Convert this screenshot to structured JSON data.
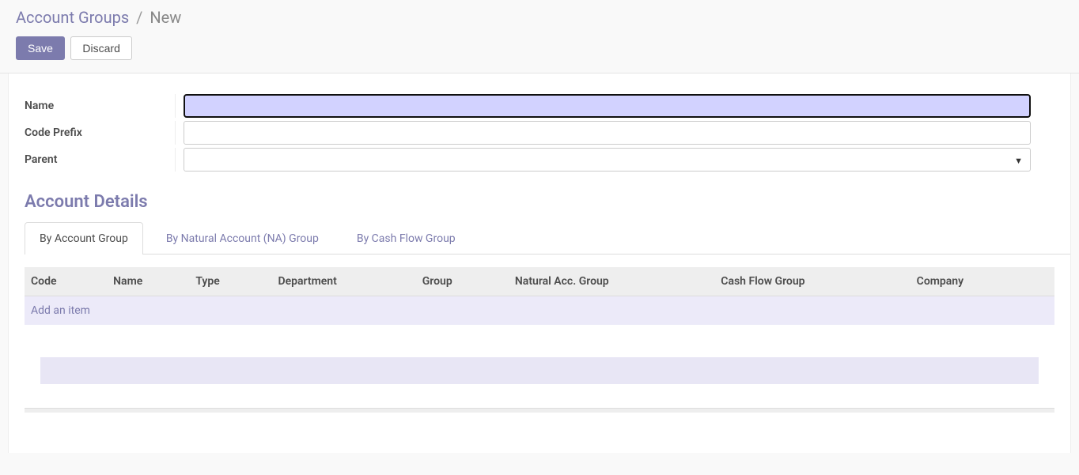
{
  "breadcrumb": {
    "parent": "Account Groups",
    "current": "New"
  },
  "actions": {
    "save": "Save",
    "discard": "Discard"
  },
  "form": {
    "name_label": "Name",
    "name_value": "",
    "code_prefix_label": "Code Prefix",
    "code_prefix_value": "",
    "parent_label": "Parent",
    "parent_value": ""
  },
  "section_title": "Account Details",
  "tabs": [
    {
      "label": "By Account Group",
      "active": true
    },
    {
      "label": "By Natural Account (NA) Group",
      "active": false
    },
    {
      "label": "By Cash Flow Group",
      "active": false
    }
  ],
  "table": {
    "columns": [
      "Code",
      "Name",
      "Type",
      "Department",
      "Group",
      "Natural Acc. Group",
      "Cash Flow Group",
      "Company"
    ],
    "add_item_label": "Add an item"
  }
}
